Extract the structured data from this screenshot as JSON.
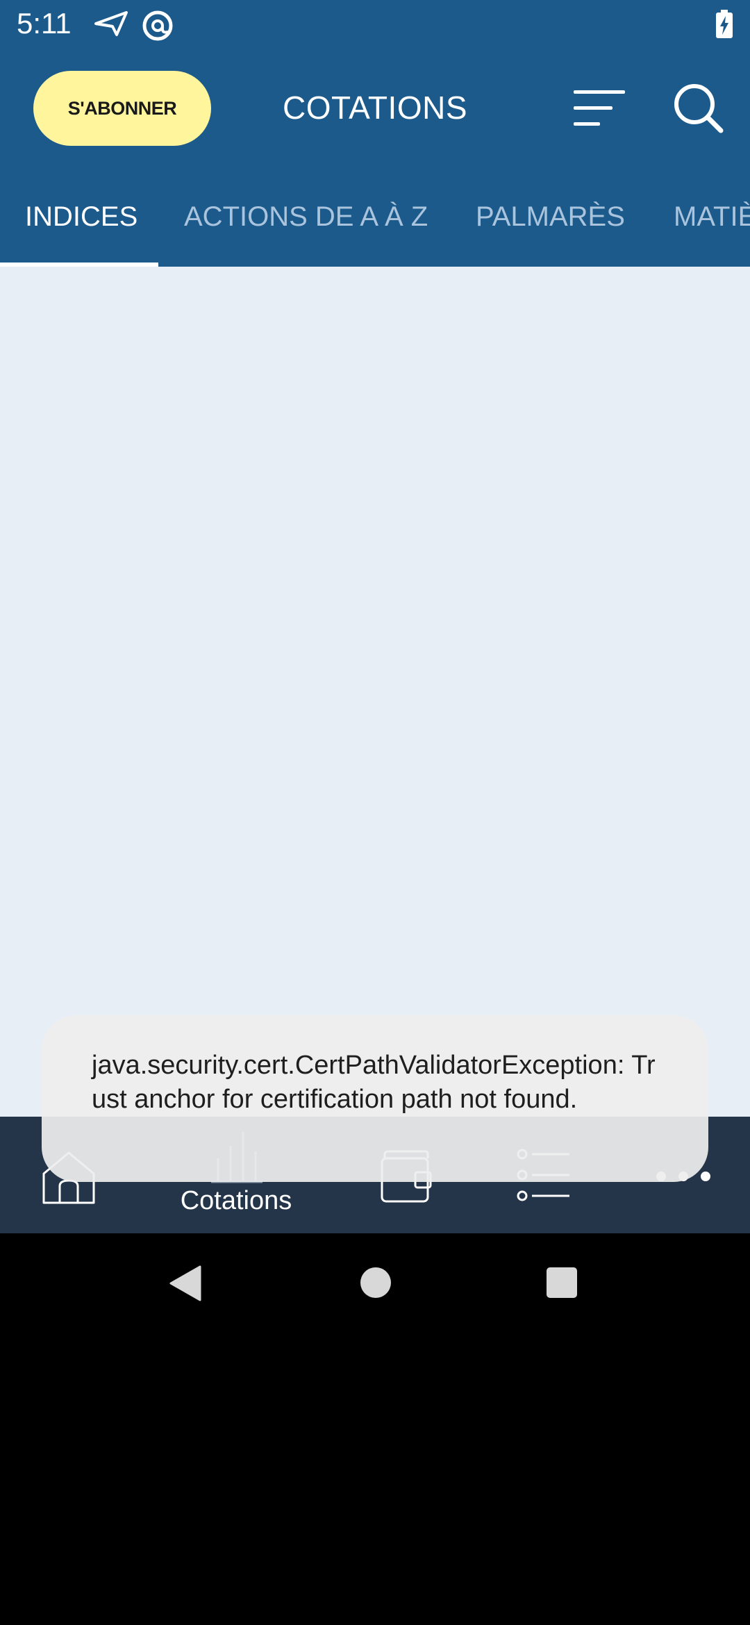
{
  "status_bar": {
    "time": "5:11",
    "icons": [
      "send-icon",
      "at-sign-icon",
      "battery-charging-icon"
    ]
  },
  "app_bar": {
    "subscribe_label": "S'ABONNER",
    "title": "COTATIONS",
    "icons": [
      "filter-icon",
      "search-icon"
    ]
  },
  "tabs": [
    {
      "label": "INDICES",
      "active": true
    },
    {
      "label": "ACTIONS DE A À Z",
      "active": false
    },
    {
      "label": "PALMARÈS",
      "active": false
    },
    {
      "label": "MATIÈ",
      "active": false
    }
  ],
  "bottom_nav": {
    "items": [
      {
        "icon": "home-icon",
        "label": ""
      },
      {
        "icon": "bar-chart-icon",
        "label": "Cotations"
      },
      {
        "icon": "wallet-icon",
        "label": ""
      },
      {
        "icon": "list-icon",
        "label": ""
      },
      {
        "icon": "more-icon",
        "label": ""
      }
    ]
  },
  "toast": {
    "message": "java.security.cert.CertPathValidatorException: Trust anchor for certification path not found."
  },
  "colors": {
    "primary": "#1c5a8c",
    "subscribe_bg": "#fff59d",
    "content_bg": "#e7eef6",
    "bottom_nav_bg": "#243449",
    "toast_bg": "#eeeeee"
  }
}
